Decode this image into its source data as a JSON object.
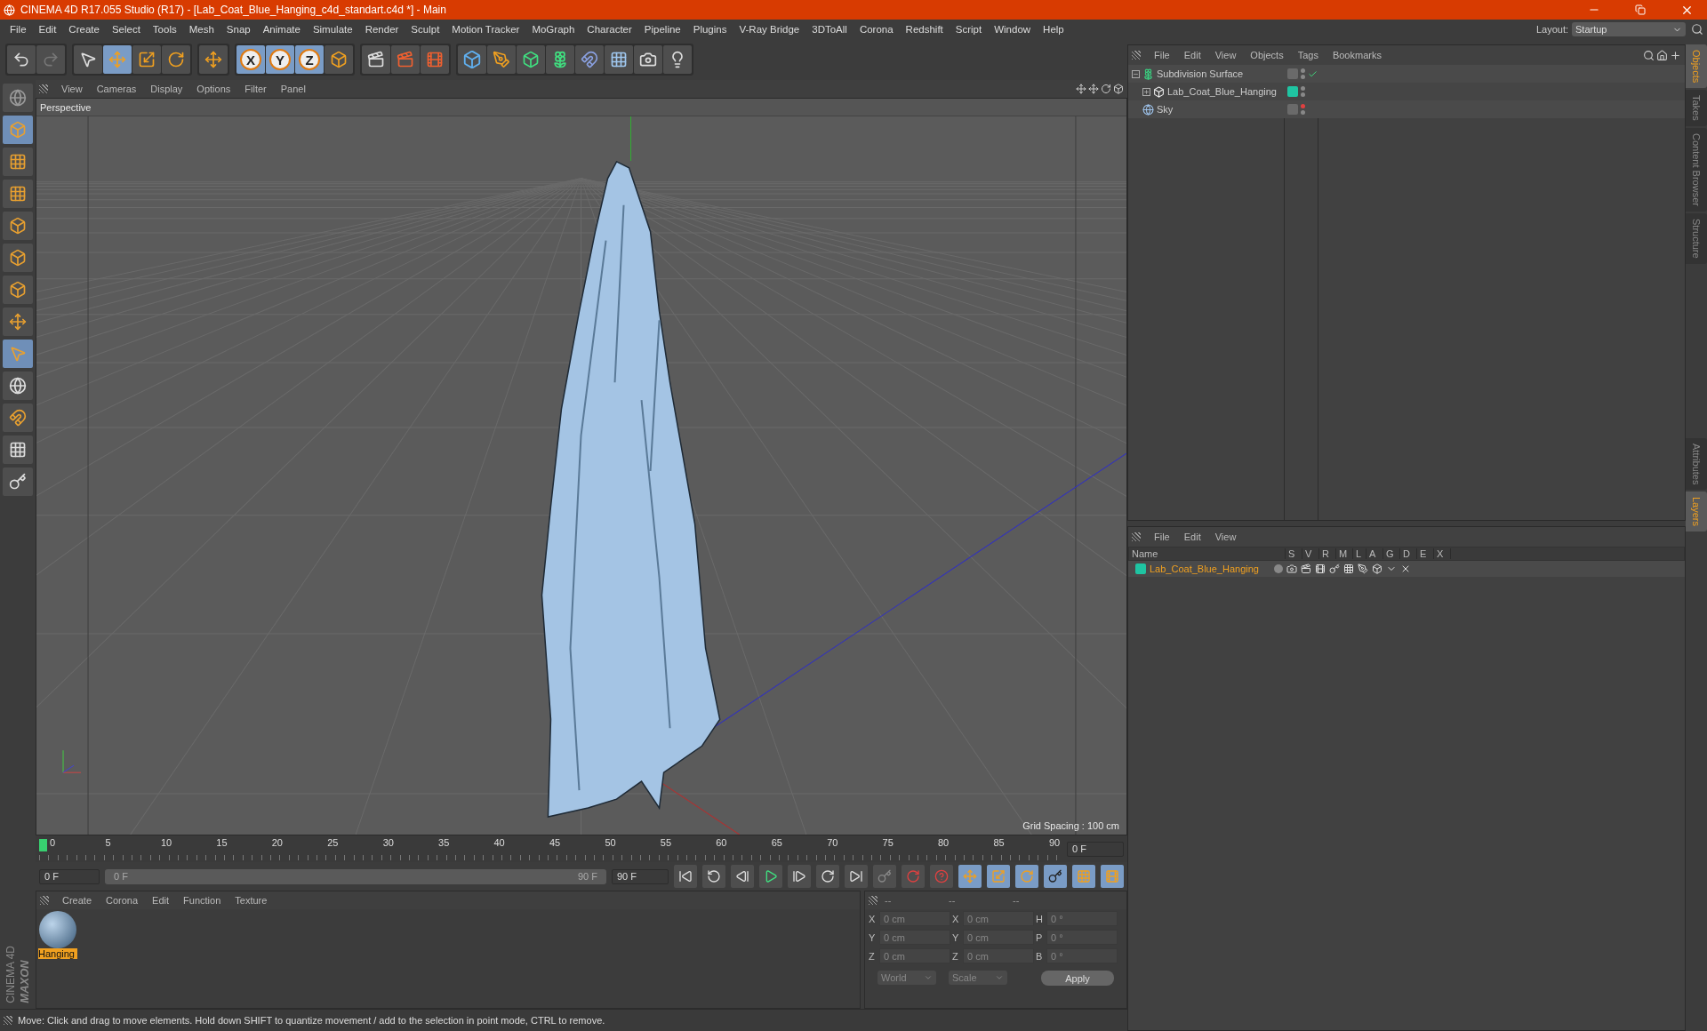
{
  "window": {
    "title": "CINEMA 4D R17.055 Studio (R17) - [Lab_Coat_Blue_Hanging_c4d_standart.c4d *] - Main"
  },
  "menu": [
    "File",
    "Edit",
    "Create",
    "Select",
    "Tools",
    "Mesh",
    "Snap",
    "Animate",
    "Simulate",
    "Render",
    "Sculpt",
    "Motion Tracker",
    "MoGraph",
    "Character",
    "Pipeline",
    "Plugins",
    "V-Ray Bridge",
    "3DToAll",
    "Corona",
    "Redshift",
    "Script",
    "Window",
    "Help"
  ],
  "layout": {
    "label": "Layout:",
    "value": "Startup"
  },
  "axis_lock": [
    {
      "label": "X",
      "selected": true
    },
    {
      "label": "Y",
      "selected": true
    },
    {
      "label": "Z",
      "selected": true
    }
  ],
  "viewport": {
    "menu": [
      "View",
      "Cameras",
      "Display",
      "Options",
      "Filter",
      "Panel"
    ],
    "camera": "Perspective",
    "grid_spacing": "Grid Spacing : 100 cm"
  },
  "timeline": {
    "ticks": [
      "0",
      "5",
      "10",
      "15",
      "20",
      "25",
      "30",
      "35",
      "40",
      "45",
      "50",
      "55",
      "60",
      "65",
      "70",
      "75",
      "80",
      "85",
      "90"
    ],
    "current_frame": "0 F",
    "start_field": "0 F",
    "range_start": "0 F",
    "range_end": "90 F",
    "range_slider": {
      "level": 1
    },
    "end_field": "90 F"
  },
  "material_manager": {
    "menu": [
      "Create",
      "Corona",
      "Edit",
      "Function",
      "Texture"
    ],
    "materials": [
      {
        "name": "Hanging",
        "selected": true
      }
    ]
  },
  "coordinates": {
    "headers": [
      "--",
      "--",
      "--"
    ],
    "rows": [
      {
        "fields": [
          {
            "label": "X",
            "value": "0 cm"
          },
          {
            "label": "X",
            "value": "0 cm"
          },
          {
            "label": "H",
            "value": "0 °"
          }
        ]
      },
      {
        "fields": [
          {
            "label": "Y",
            "value": "0 cm"
          },
          {
            "label": "Y",
            "value": "0 cm"
          },
          {
            "label": "P",
            "value": "0 °"
          }
        ]
      },
      {
        "fields": [
          {
            "label": "Z",
            "value": "0 cm"
          },
          {
            "label": "Z",
            "value": "0 cm"
          },
          {
            "label": "B",
            "value": "0 °"
          }
        ]
      }
    ],
    "mode": "World",
    "transform": "Scale",
    "apply": "Apply"
  },
  "logo": {
    "line1": "MAXON",
    "line2": "CINEMA 4D"
  },
  "status_bar": "Move: Click and drag to move elements. Hold down SHIFT to quantize movement / add to the selection in point mode, CTRL to remove.",
  "object_manager": {
    "menu": [
      "File",
      "Edit",
      "View",
      "Objects",
      "Tags",
      "Bookmarks"
    ],
    "objects": [
      {
        "name": "Subdivision Surface",
        "kind": "generator",
        "expanded": true,
        "enabled": true,
        "visible_in_editor": true,
        "children": [
          {
            "name": "Lab_Coat_Blue_Hanging",
            "kind": "polygon",
            "expanded": false,
            "visible_in_editor": true,
            "color": "#1fc4a2"
          }
        ]
      },
      {
        "name": "Sky",
        "kind": "sky",
        "visible_in_editor": false
      }
    ]
  },
  "layer_manager": {
    "menu": [
      "File",
      "Edit",
      "View"
    ],
    "columns": [
      "Name",
      "S",
      "V",
      "R",
      "M",
      "L",
      "A",
      "G",
      "D",
      "E",
      "X"
    ],
    "layers": [
      {
        "name": "Lab_Coat_Blue_Hanging",
        "color": "#1fc4a2"
      }
    ]
  },
  "side_tabs_top": [
    {
      "label": "Objects",
      "selected": true
    },
    {
      "label": "Takes",
      "selected": false
    },
    {
      "label": "Content Browser",
      "selected": false
    },
    {
      "label": "Structure",
      "selected": false
    }
  ],
  "side_tabs_bottom": [
    {
      "label": "Attributes",
      "selected": false
    },
    {
      "label": "Layers",
      "selected": true
    }
  ]
}
